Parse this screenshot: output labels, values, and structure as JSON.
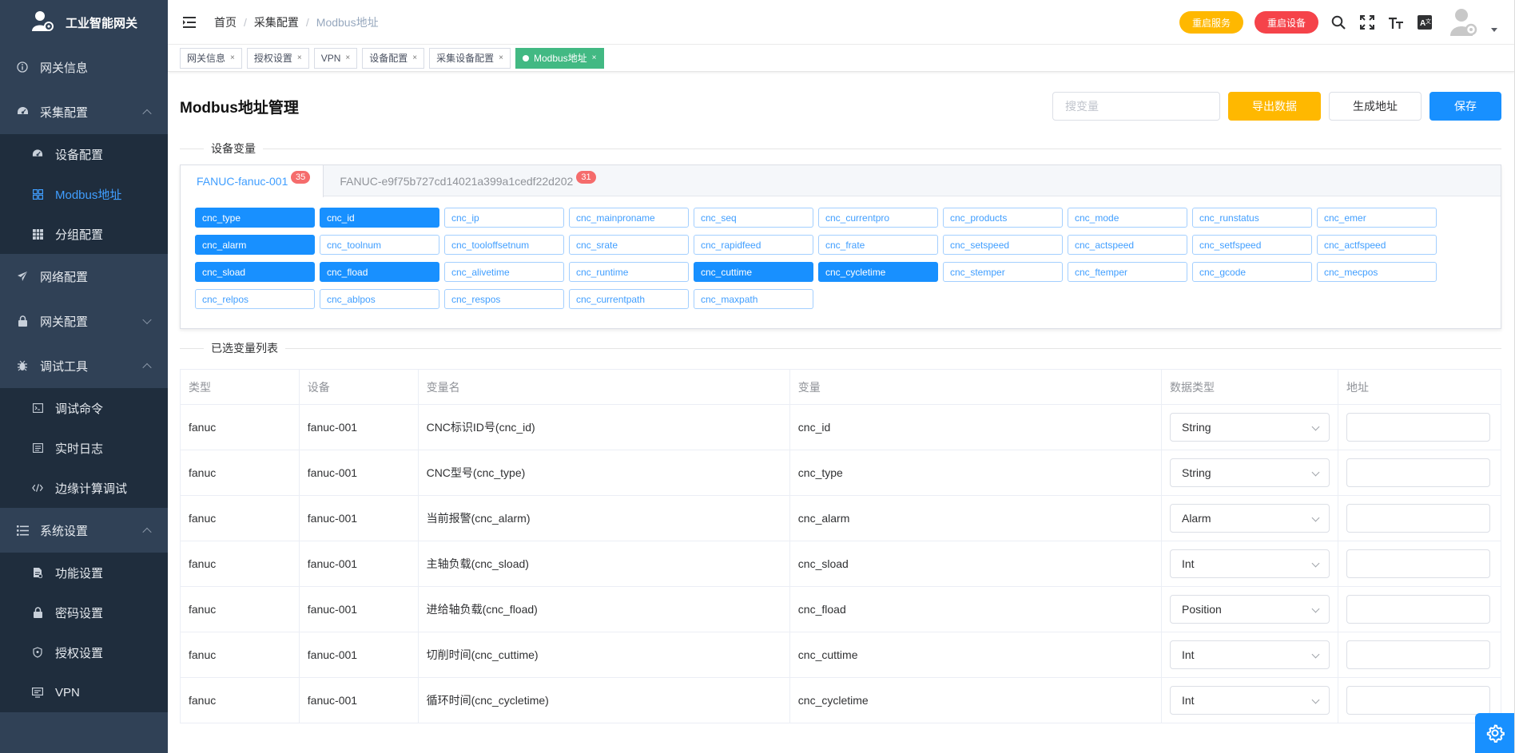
{
  "sidebar": {
    "app_title": "工业智能网关",
    "items": [
      {
        "label": "网关信息",
        "icon": "info-icon"
      },
      {
        "label": "采集配置",
        "icon": "dashboard-icon",
        "expanded": true,
        "children": [
          {
            "label": "设备配置",
            "icon": "dashboard-icon"
          },
          {
            "label": "Modbus地址",
            "icon": "grid-icon",
            "active": true
          },
          {
            "label": "分组配置",
            "icon": "table-icon"
          }
        ]
      },
      {
        "label": "网络配置",
        "icon": "send-icon"
      },
      {
        "label": "网关配置",
        "icon": "lock-icon",
        "expanded": false
      },
      {
        "label": "调试工具",
        "icon": "bug-icon",
        "expanded": true,
        "children": [
          {
            "label": "调试命令",
            "icon": "terminal-icon"
          },
          {
            "label": "实时日志",
            "icon": "log-icon"
          },
          {
            "label": "边缘计算调试",
            "icon": "code-icon"
          }
        ]
      },
      {
        "label": "系统设置",
        "icon": "list-icon",
        "expanded": true,
        "children": [
          {
            "label": "功能设置",
            "icon": "doc-icon"
          },
          {
            "label": "密码设置",
            "icon": "lock-icon"
          },
          {
            "label": "授权设置",
            "icon": "shield-icon"
          },
          {
            "label": "VPN",
            "icon": "monitor-icon"
          }
        ]
      }
    ]
  },
  "header": {
    "breadcrumb": [
      "首页",
      "采集配置",
      "Modbus地址"
    ],
    "restart_service": "重启服务",
    "restart_device": "重启设备"
  },
  "tags": [
    {
      "label": "网关信息"
    },
    {
      "label": "授权设置"
    },
    {
      "label": "VPN"
    },
    {
      "label": "设备配置"
    },
    {
      "label": "采集设备配置"
    },
    {
      "label": "Modbus地址",
      "active": true
    }
  ],
  "page": {
    "title": "Modbus地址管理",
    "search_placeholder": "搜变量",
    "export_label": "导出数据",
    "generate_label": "生成地址",
    "save_label": "保存",
    "section_vars": "设备变量",
    "section_selected": "已选变量列表"
  },
  "device_tabs": [
    {
      "label": "FANUC-fanuc-001",
      "count": "35",
      "active": true
    },
    {
      "label": "FANUC-e9f75b727cd14021a399a1cedf22d202",
      "count": "31",
      "active": false
    }
  ],
  "variables": [
    {
      "name": "cnc_type",
      "selected": true
    },
    {
      "name": "cnc_id",
      "selected": true
    },
    {
      "name": "cnc_ip",
      "selected": false
    },
    {
      "name": "cnc_mainproname",
      "selected": false
    },
    {
      "name": "cnc_seq",
      "selected": false
    },
    {
      "name": "cnc_currentpro",
      "selected": false
    },
    {
      "name": "cnc_products",
      "selected": false
    },
    {
      "name": "cnc_mode",
      "selected": false
    },
    {
      "name": "cnc_runstatus",
      "selected": false
    },
    {
      "name": "cnc_emer",
      "selected": false
    },
    {
      "name": "cnc_alarm",
      "selected": true
    },
    {
      "name": "cnc_toolnum",
      "selected": false
    },
    {
      "name": "cnc_tooloffsetnum",
      "selected": false
    },
    {
      "name": "cnc_srate",
      "selected": false
    },
    {
      "name": "cnc_rapidfeed",
      "selected": false
    },
    {
      "name": "cnc_frate",
      "selected": false
    },
    {
      "name": "cnc_setspeed",
      "selected": false
    },
    {
      "name": "cnc_actspeed",
      "selected": false
    },
    {
      "name": "cnc_setfspeed",
      "selected": false
    },
    {
      "name": "cnc_actfspeed",
      "selected": false
    },
    {
      "name": "cnc_sload",
      "selected": true
    },
    {
      "name": "cnc_fload",
      "selected": true
    },
    {
      "name": "cnc_alivetime",
      "selected": false
    },
    {
      "name": "cnc_runtime",
      "selected": false
    },
    {
      "name": "cnc_cuttime",
      "selected": true
    },
    {
      "name": "cnc_cycletime",
      "selected": true
    },
    {
      "name": "cnc_stemper",
      "selected": false
    },
    {
      "name": "cnc_ftemper",
      "selected": false
    },
    {
      "name": "cnc_gcode",
      "selected": false
    },
    {
      "name": "cnc_mecpos",
      "selected": false
    },
    {
      "name": "cnc_relpos",
      "selected": false
    },
    {
      "name": "cnc_ablpos",
      "selected": false
    },
    {
      "name": "cnc_respos",
      "selected": false
    },
    {
      "name": "cnc_currentpath",
      "selected": false
    },
    {
      "name": "cnc_maxpath",
      "selected": false
    }
  ],
  "table": {
    "columns": [
      "类型",
      "设备",
      "变量名",
      "变量",
      "数据类型",
      "地址"
    ],
    "rows": [
      {
        "type": "fanuc",
        "device": "fanuc-001",
        "var_name": "CNC标识ID号(cnc_id)",
        "var": "cnc_id",
        "data_type": "String",
        "address": ""
      },
      {
        "type": "fanuc",
        "device": "fanuc-001",
        "var_name": "CNC型号(cnc_type)",
        "var": "cnc_type",
        "data_type": "String",
        "address": ""
      },
      {
        "type": "fanuc",
        "device": "fanuc-001",
        "var_name": "当前报警(cnc_alarm)",
        "var": "cnc_alarm",
        "data_type": "Alarm",
        "address": ""
      },
      {
        "type": "fanuc",
        "device": "fanuc-001",
        "var_name": "主轴负载(cnc_sload)",
        "var": "cnc_sload",
        "data_type": "Int",
        "address": ""
      },
      {
        "type": "fanuc",
        "device": "fanuc-001",
        "var_name": "进给轴负载(cnc_fload)",
        "var": "cnc_fload",
        "data_type": "Position",
        "address": ""
      },
      {
        "type": "fanuc",
        "device": "fanuc-001",
        "var_name": "切削时间(cnc_cuttime)",
        "var": "cnc_cuttime",
        "data_type": "Int",
        "address": ""
      },
      {
        "type": "fanuc",
        "device": "fanuc-001",
        "var_name": "循环时间(cnc_cycletime)",
        "var": "cnc_cycletime",
        "data_type": "Int",
        "address": ""
      }
    ]
  },
  "colors": {
    "sidebar_bg": "#304156",
    "submenu_bg": "#1f2d3d",
    "primary": "#1890ff",
    "warning": "#ffb800",
    "danger": "#f5434a",
    "tag_active": "#42b983"
  }
}
